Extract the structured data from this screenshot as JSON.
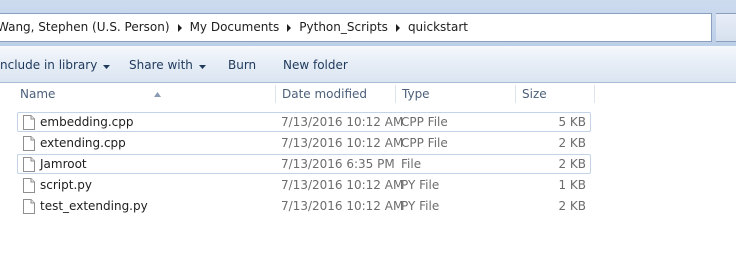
{
  "address": {
    "crumbs": [
      "Wang, Stephen (U.S. Person)",
      "My Documents",
      "Python_Scripts",
      "quickstart"
    ]
  },
  "toolbar": {
    "include_label": "nclude in library",
    "share_label": "Share with",
    "burn_label": "Burn",
    "new_folder_label": "New folder"
  },
  "columns": {
    "name": "Name",
    "date": "Date modified",
    "type": "Type",
    "size": "Size"
  },
  "files": [
    {
      "name": "embedding.cpp",
      "date": "7/13/2016 10:12 AM",
      "type": "CPP File",
      "size": "5 KB"
    },
    {
      "name": "extending.cpp",
      "date": "7/13/2016 10:12 AM",
      "type": "CPP File",
      "size": "2 KB"
    },
    {
      "name": "Jamroot",
      "date": "7/13/2016 6:35 PM",
      "type": "File",
      "size": "2 KB"
    },
    {
      "name": "script.py",
      "date": "7/13/2016 10:12 AM",
      "type": "PY File",
      "size": "1 KB"
    },
    {
      "name": "test_extending.py",
      "date": "7/13/2016 10:12 AM",
      "type": "PY File",
      "size": "2 KB"
    }
  ],
  "icons": {
    "breadcrumb_separator": "chevron-right-icon",
    "dropdown": "caret-down-icon",
    "sort": "sort-ascending-icon",
    "file": "document-icon"
  },
  "colors": {
    "address_bg": "#cddbee",
    "toolbar_text": "#1e395b",
    "header_text": "#4c607a",
    "row_outline": "#c3d3e8"
  }
}
